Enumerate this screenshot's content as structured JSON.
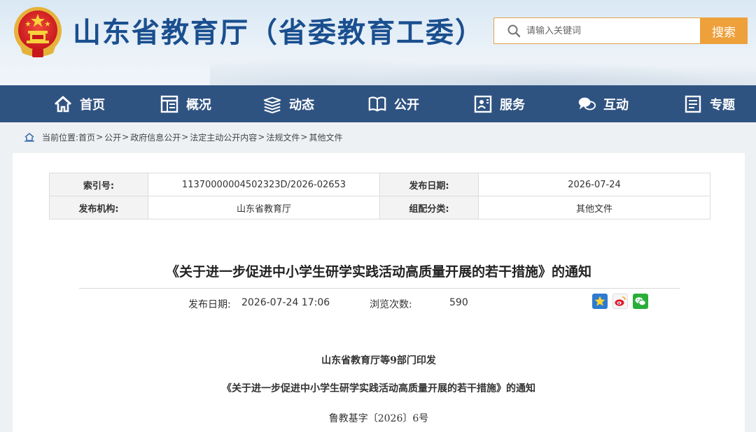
{
  "header": {
    "site_title": "山东省教育厅（省委教育工委）",
    "search": {
      "placeholder": "请输入关键词",
      "button_label": "搜索"
    }
  },
  "nav": {
    "items": [
      {
        "label": "首页",
        "icon": "home-icon"
      },
      {
        "label": "概况",
        "icon": "overview-icon"
      },
      {
        "label": "动态",
        "icon": "books-icon"
      },
      {
        "label": "公开",
        "icon": "open-book-icon"
      },
      {
        "label": "服务",
        "icon": "service-icon"
      },
      {
        "label": "互动",
        "icon": "chat-icon"
      },
      {
        "label": "专题",
        "icon": "document-icon"
      }
    ]
  },
  "breadcrumb": {
    "prefix": "当前位置:",
    "items": [
      "首页",
      "公开",
      "政府信息公开",
      "法定主动公开内容",
      "法规文件",
      "其他文件"
    ],
    "separator": ">"
  },
  "meta": {
    "index_label": "索引号:",
    "index_value": "11370000004502323D/2026-02653",
    "date_label": "发布日期:",
    "date_value": "2026-07-24",
    "org_label": "发布机构:",
    "org_value": "山东省教育厅",
    "category_label": "组配分类:",
    "category_value": "其他文件"
  },
  "article": {
    "title": "《关于进一步促进中小学生研学实践活动高质量开展的若干措施》的通知",
    "pub_date_label": "发布日期:",
    "pub_date_value": "2026-07-24 17:06",
    "views_label": "浏览次数:",
    "views_value": "590",
    "body": [
      "山东省教育厅等9部门印发",
      "《关于进一步促进中小学生研学实践活动高质量开展的若干措施》的通知",
      "鲁教基字〔2026〕6号"
    ]
  },
  "colors": {
    "nav_bg": "#2f5381",
    "title_blue": "#1a4f8f",
    "search_orange": "#eea03a"
  }
}
